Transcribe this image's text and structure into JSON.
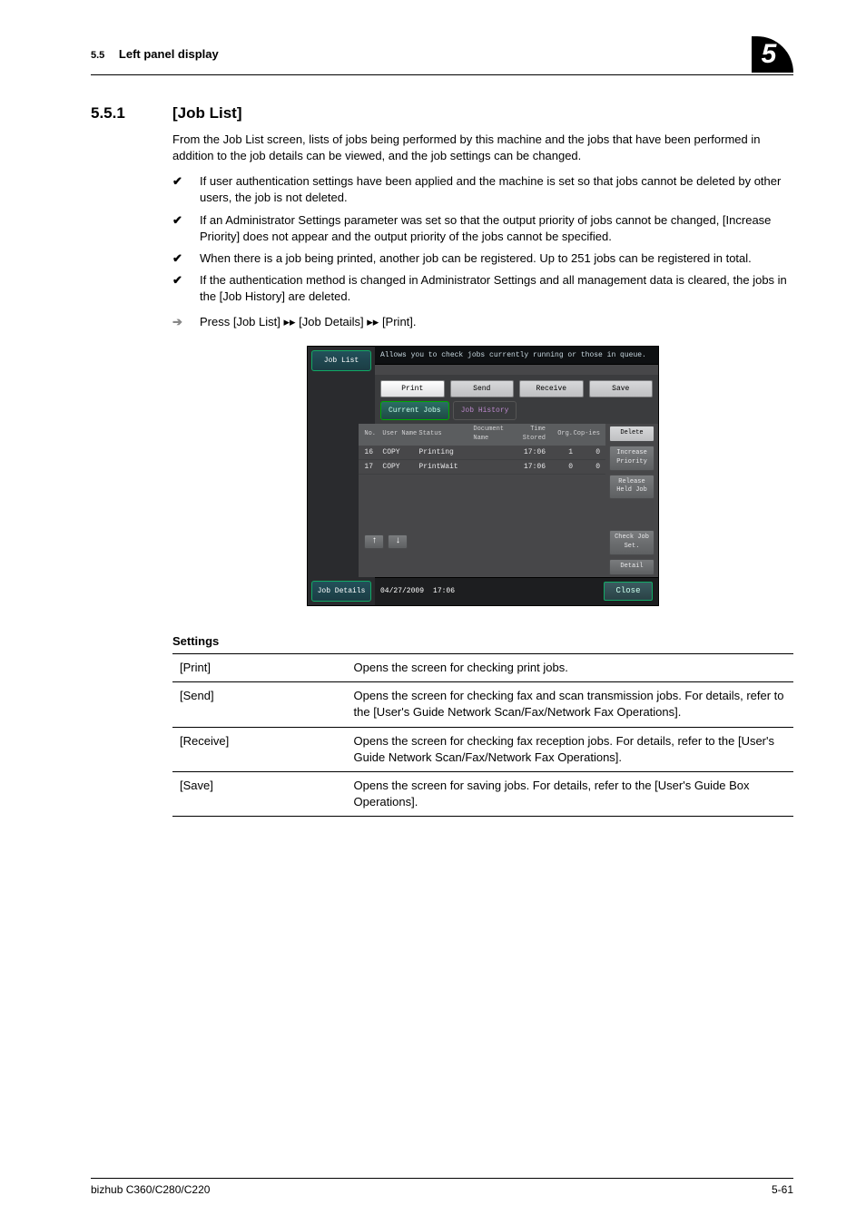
{
  "header": {
    "section_no": "5.5",
    "section_title": "Left panel display",
    "chapter": "5"
  },
  "section": {
    "number": "5.5.1",
    "title": "[Job List]"
  },
  "intro": "From the Job List screen, lists of jobs being performed by this machine and the jobs that have been performed in addition to the job details can be viewed, and the job settings can be changed.",
  "bullets": [
    "If user authentication settings have been applied and the machine is set so that jobs cannot be deleted by other users, the job is not deleted.",
    "If an Administrator Settings parameter was set so that the output priority of jobs cannot be changed, [Increase Priority] does not appear and the output priority of the jobs cannot be specified.",
    "When there is a job being printed, another job can be registered. Up to 251 jobs can be registered in total.",
    "If the authentication method is changed in Administrator Settings and all management data is cleared, the jobs in the [Job History] are deleted."
  ],
  "press_line": "Press [Job List] ▸▸ [Job Details] ▸▸ [Print].",
  "screenshot": {
    "left_tab_top": "Job List",
    "left_tab_bottom": "Job Details",
    "banner": "Allows you to check jobs currently running or those in queue.",
    "tabs": [
      "Print",
      "Send",
      "Receive",
      "Save"
    ],
    "subtabs": [
      "Current Jobs",
      "Job History"
    ],
    "columns": {
      "no": "No.",
      "user": "User Name",
      "status": "Status",
      "doc": "Document Name",
      "time": "Time Stored",
      "org": "Org.",
      "cop": "Cop-ies"
    },
    "rows": [
      {
        "no": "16",
        "user": "COPY",
        "status": "Printing",
        "doc": "",
        "time": "17:06",
        "org": "1",
        "cop": "0"
      },
      {
        "no": "17",
        "user": "COPY",
        "status": "PrintWait",
        "doc": "",
        "time": "17:06",
        "org": "0",
        "cop": "0"
      }
    ],
    "side_buttons": {
      "delete": "Delete",
      "increase": "Increase Priority",
      "release": "Release Held Job",
      "check": "Check Job Set.",
      "detail": "Detail"
    },
    "date": "04/27/2009",
    "time": "17:06",
    "close": "Close"
  },
  "settings": {
    "heading": "Settings",
    "rows": [
      {
        "k": "[Print]",
        "v": "Opens the screen for checking print jobs."
      },
      {
        "k": "[Send]",
        "v": "Opens the screen for checking fax and scan transmission jobs. For details, refer to the [User's Guide Network Scan/Fax/Network Fax Operations]."
      },
      {
        "k": "[Receive]",
        "v": "Opens the screen for checking fax reception jobs. For details, refer to the [User's Guide Network Scan/Fax/Network Fax Operations]."
      },
      {
        "k": "[Save]",
        "v": "Opens the screen for saving jobs. For details, refer to the [User's Guide Box Operations]."
      }
    ]
  },
  "footer": {
    "left": "bizhub C360/C280/C220",
    "right": "5-61"
  }
}
